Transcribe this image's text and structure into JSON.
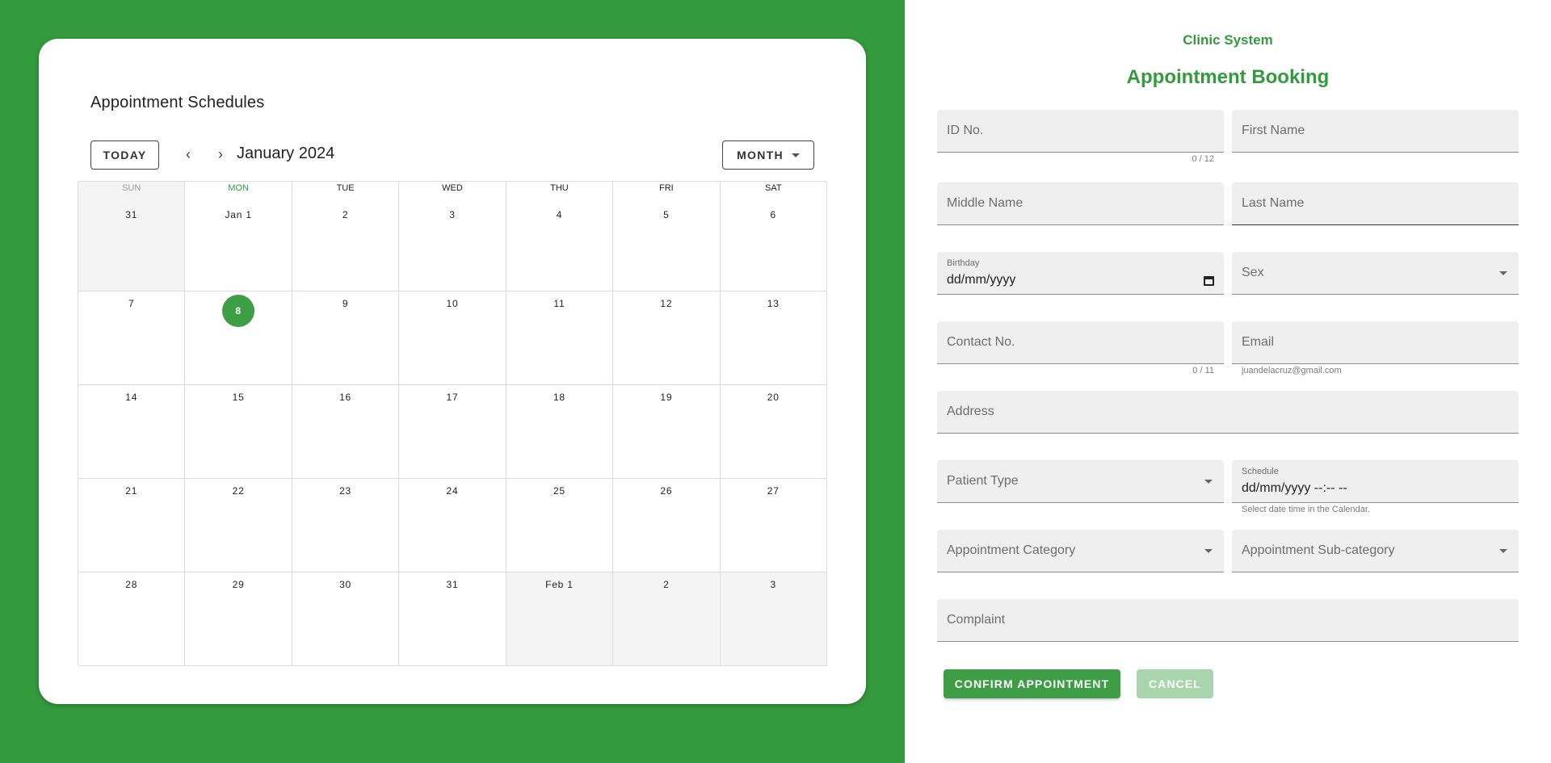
{
  "calendar": {
    "title": "Appointment Schedules",
    "today_label": "TODAY",
    "prev_icon": "‹",
    "next_icon": "›",
    "month_title": "January 2024",
    "view_label": "MONTH",
    "weekdays": [
      "SUN",
      "MON",
      "TUE",
      "WED",
      "THU",
      "FRI",
      "SAT"
    ],
    "weeks": [
      [
        "31",
        "Jan 1",
        "2",
        "3",
        "4",
        "5",
        "6"
      ],
      [
        "7",
        "8",
        "9",
        "10",
        "11",
        "12",
        "13"
      ],
      [
        "14",
        "15",
        "16",
        "17",
        "18",
        "19",
        "20"
      ],
      [
        "21",
        "22",
        "23",
        "24",
        "25",
        "26",
        "27"
      ],
      [
        "28",
        "29",
        "30",
        "31",
        "Feb 1",
        "2",
        "3"
      ]
    ],
    "today_date": "8"
  },
  "form": {
    "brand": "Clinic System",
    "title": "Appointment Booking",
    "id_no": {
      "label": "ID No.",
      "counter": "0 / 12"
    },
    "first_name": {
      "label": "First Name"
    },
    "middle_name": {
      "label": "Middle Name"
    },
    "last_name": {
      "label": "Last Name"
    },
    "birthday": {
      "label": "Birthday",
      "value": "dd/mm/yyyy"
    },
    "sex": {
      "label": "Sex"
    },
    "contact_no": {
      "label": "Contact No.",
      "counter": "0 / 11"
    },
    "email": {
      "label": "Email",
      "hint": "juandelacruz@gmail.com"
    },
    "address": {
      "label": "Address"
    },
    "patient_type": {
      "label": "Patient Type"
    },
    "schedule": {
      "label": "Schedule",
      "value": "dd/mm/yyyy --:-- --",
      "hint": "Select date time in the Calendar."
    },
    "appointment_category": {
      "label": "Appointment Category"
    },
    "appointment_subcategory": {
      "label": "Appointment Sub-category"
    },
    "complaint": {
      "label": "Complaint"
    },
    "confirm_label": "CONFIRM APPOINTMENT",
    "cancel_label": "CANCEL"
  },
  "colors": {
    "accent": "#339a3d",
    "button": "#3e9e46",
    "button_disabled": "#a8d5ab"
  }
}
